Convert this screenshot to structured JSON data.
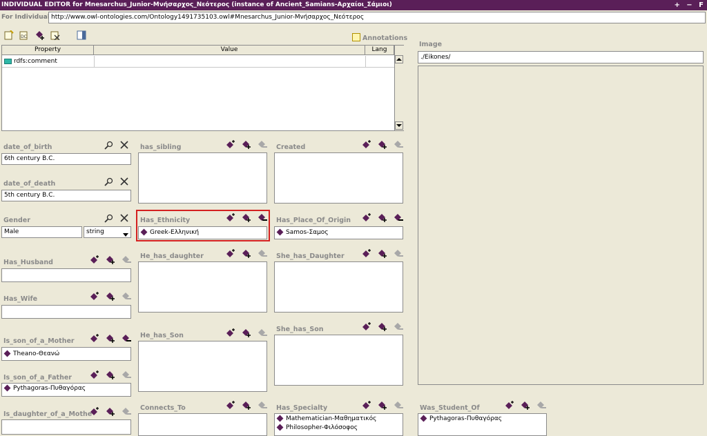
{
  "window": {
    "title": "INDIVIDUAL EDITOR for Mnesarchus_Junior-Μνήσαρχος_Νεότερος  (instance of Ancient_Samians-Αρχαίοι_Σάμιοι)",
    "controls": "+ − F"
  },
  "for_individual": {
    "label": "For Individual:",
    "value": "http://www.owl-ontologies.com/Ontology1491735103.owl#Mnesarchus_Junior-Μνήσαρχος_Νεότερος"
  },
  "annotations": {
    "label": "Annotations",
    "columns": [
      "Property",
      "Value",
      "Lang"
    ],
    "rows": [
      {
        "property": "rdfs:comment",
        "value": "",
        "lang": ""
      }
    ]
  },
  "image": {
    "label": "Image",
    "value": "./Eikones/"
  },
  "fields": {
    "date_of_birth": {
      "label": "date_of_birth",
      "value": "6th century B.C."
    },
    "date_of_death": {
      "label": "date_of_death",
      "value": "5th century B.C."
    },
    "gender": {
      "label": "Gender",
      "value": "Male",
      "type": "string"
    },
    "has_husband": {
      "label": "Has_Husband"
    },
    "has_wife": {
      "label": "Has_Wife"
    },
    "is_son_of_a_mother": {
      "label": "Is_son_of_a_Mother",
      "value": "Theano-Θεανώ"
    },
    "is_son_of_a_father": {
      "label": "Is_son_of_a_Father",
      "value": "Pythagoras-Πυθαγόρας"
    },
    "is_daughter_of_a_mother": {
      "label": "Is_daughter_of_a_Mothe"
    },
    "has_sibling": {
      "label": "has_sibling"
    },
    "has_ethnicity": {
      "label": "Has_Ethnicity",
      "value": "Greek-Ελληνική"
    },
    "he_has_daughter": {
      "label": "He_has_daughter"
    },
    "he_has_son": {
      "label": "He_has_Son"
    },
    "connects_to": {
      "label": "Connects_To"
    },
    "created": {
      "label": "Created"
    },
    "has_place_of_origin": {
      "label": "Has_Place_Of_Origin",
      "value": "Samos-Σαμος"
    },
    "she_has_daughter": {
      "label": "She_has_Daughter"
    },
    "she_has_son": {
      "label": "She_has_Son"
    },
    "has_specialty": {
      "label": "Has_Specialty",
      "values": [
        "Mathematician-Μαθηματικός",
        "Philosopher-Φιλόσοφος"
      ]
    },
    "was_student_of": {
      "label": "Was_Student_Of",
      "value": "Pythagoras-Πυθαγόρας"
    }
  },
  "colors": {
    "titlebar": "#5a1f58",
    "instance_icon": "#5a1f58",
    "highlight": "#d42020",
    "background": "#ece9d8"
  }
}
